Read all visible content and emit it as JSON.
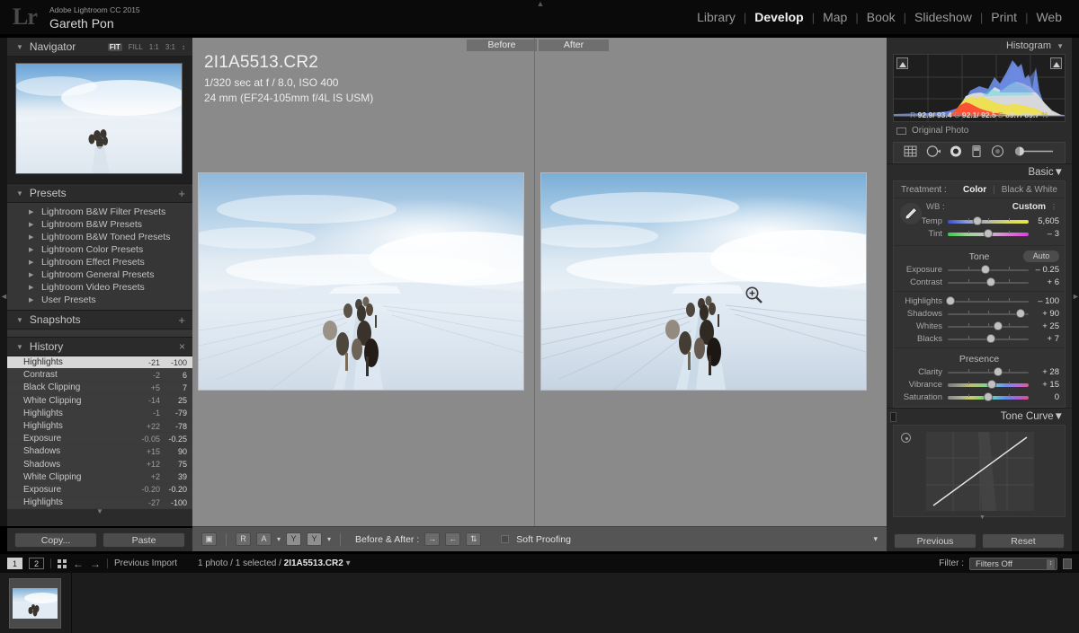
{
  "app": {
    "logo": "Lr",
    "product": "Adobe Lightroom CC 2015",
    "user": "Gareth Pon"
  },
  "modules": [
    {
      "label": "Library",
      "active": false
    },
    {
      "label": "Develop",
      "active": true
    },
    {
      "label": "Map",
      "active": false
    },
    {
      "label": "Book",
      "active": false
    },
    {
      "label": "Slideshow",
      "active": false
    },
    {
      "label": "Print",
      "active": false
    },
    {
      "label": "Web",
      "active": false
    }
  ],
  "module_separator": "|",
  "left_panel": {
    "navigator": {
      "title": "Navigator",
      "zoom_levels": [
        "FIT",
        "FILL",
        "1:1",
        "3:1"
      ],
      "zoom_active": "FIT",
      "zoom_more": "↕"
    },
    "presets": {
      "title": "Presets",
      "add": "+",
      "items": [
        "Lightroom B&W Filter Presets",
        "Lightroom B&W Presets",
        "Lightroom B&W Toned Presets",
        "Lightroom Color Presets",
        "Lightroom Effect Presets",
        "Lightroom General Presets",
        "Lightroom Video Presets",
        "User Presets"
      ]
    },
    "snapshots": {
      "title": "Snapshots",
      "add": "+"
    },
    "history": {
      "title": "History",
      "close": "×",
      "rows": [
        {
          "name": "Highlights",
          "delta": "-21",
          "value": "-100",
          "selected": true
        },
        {
          "name": "Contrast",
          "delta": "-2",
          "value": "6",
          "selected": false
        },
        {
          "name": "Black Clipping",
          "delta": "+5",
          "value": "7",
          "selected": false
        },
        {
          "name": "White Clipping",
          "delta": "-14",
          "value": "25",
          "selected": false
        },
        {
          "name": "Highlights",
          "delta": "-1",
          "value": "-79",
          "selected": false
        },
        {
          "name": "Highlights",
          "delta": "+22",
          "value": "-78",
          "selected": false
        },
        {
          "name": "Exposure",
          "delta": "-0.05",
          "value": "-0.25",
          "selected": false
        },
        {
          "name": "Shadows",
          "delta": "+15",
          "value": "90",
          "selected": false
        },
        {
          "name": "Shadows",
          "delta": "+12",
          "value": "75",
          "selected": false
        },
        {
          "name": "White Clipping",
          "delta": "+2",
          "value": "39",
          "selected": false
        },
        {
          "name": "Exposure",
          "delta": "-0.20",
          "value": "-0.20",
          "selected": false
        },
        {
          "name": "Highlights",
          "delta": "-27",
          "value": "-100",
          "selected": false
        }
      ]
    },
    "copy_label": "Copy...",
    "paste_label": "Paste"
  },
  "center": {
    "before_tab": "Before",
    "after_tab": "After",
    "filename": "2I1A5513.CR2",
    "exposure_line": "1/320 sec at f / 8.0, ISO 400",
    "lens_line": "24 mm (EF24-105mm f/4L IS USM)",
    "toolbar": {
      "view_button": "▣",
      "ba_r": "R",
      "ba_a": "A",
      "ba_y1": "Y",
      "ba_y2": "Y",
      "caret": "▾",
      "before_after_label": "Before & After :",
      "copy_settings_right": "→",
      "copy_settings_left": "←",
      "swap_settings": "⇅",
      "soft_proofing": "Soft Proofing",
      "collapse": "▾"
    }
  },
  "right_panel": {
    "histogram": {
      "title": "Histogram",
      "triangle": "▼",
      "readout_r_label": "R",
      "readout_r": "92.9/ 93.4",
      "readout_g_label": "G",
      "readout_g": "92.1/ 92.5",
      "readout_b_label": "B",
      "readout_b": "89.7/ 89.7",
      "percent": "%",
      "original_photo": "Original Photo"
    },
    "tools": [
      {
        "name": "crop-overlay-tool"
      },
      {
        "name": "spot-removal-tool"
      },
      {
        "name": "red-eye-correction-tool"
      },
      {
        "name": "graduated-filter-tool"
      },
      {
        "name": "radial-filter-tool"
      },
      {
        "name": "adjustment-brush-tool"
      }
    ],
    "basic": {
      "title": "Basic",
      "triangle": "▼",
      "treatment_label": "Treatment :",
      "treatment_color": "Color",
      "treatment_bw": "Black & White",
      "treatment_sep": "|",
      "wb_label": "WB :",
      "wb_value": "Custom",
      "wb_dots": "⋮",
      "temp_label": "Temp",
      "temp_value": "5,605",
      "tint_label": "Tint",
      "tint_value": "– 3",
      "tone_title": "Tone",
      "auto_label": "Auto",
      "exposure_label": "Exposure",
      "exposure_value": "– 0.25",
      "contrast_label": "Contrast",
      "contrast_value": "+ 6",
      "highlights_label": "Highlights",
      "highlights_value": "– 100",
      "shadows_label": "Shadows",
      "shadows_value": "+ 90",
      "whites_label": "Whites",
      "whites_value": "+ 25",
      "blacks_label": "Blacks",
      "blacks_value": "+ 7",
      "presence_title": "Presence",
      "clarity_label": "Clarity",
      "clarity_value": "+ 28",
      "vibrance_label": "Vibrance",
      "vibrance_value": "+ 15",
      "saturation_label": "Saturation",
      "saturation_value": "0"
    },
    "tone_curve": {
      "title": "Tone Curve",
      "triangle": "▼"
    },
    "previous_label": "Previous",
    "reset_label": "Reset"
  },
  "filmstrip_bar": {
    "screen1": "1",
    "screen2": "2",
    "back_arrow": "←",
    "forward_arrow": "→",
    "source": "Previous Import",
    "selection": "1 photo / 1 selected / ",
    "selected_file": "2I1A5513.CR2",
    "selection_caret": "▾",
    "filter_label": "Filter :",
    "filter_value": "Filters Off",
    "filter_caret": "↕"
  },
  "slider_positions": {
    "temp": 37,
    "tint": 50,
    "exposure": 47,
    "contrast": 53,
    "highlights": 3,
    "shadows": 90,
    "whites": 62,
    "blacks": 53,
    "clarity": 62,
    "vibrance": 54,
    "saturation": 50
  },
  "colors": {
    "panel_bg": "#2b2b2b",
    "center_bg": "#8a8a8a",
    "accent_text": "#f0f0f0",
    "histogram_red": "#ff2d2d",
    "histogram_yellow": "#f2e23c",
    "histogram_blue": "#6f8fe8",
    "histogram_gray": "#dcdcdc"
  }
}
